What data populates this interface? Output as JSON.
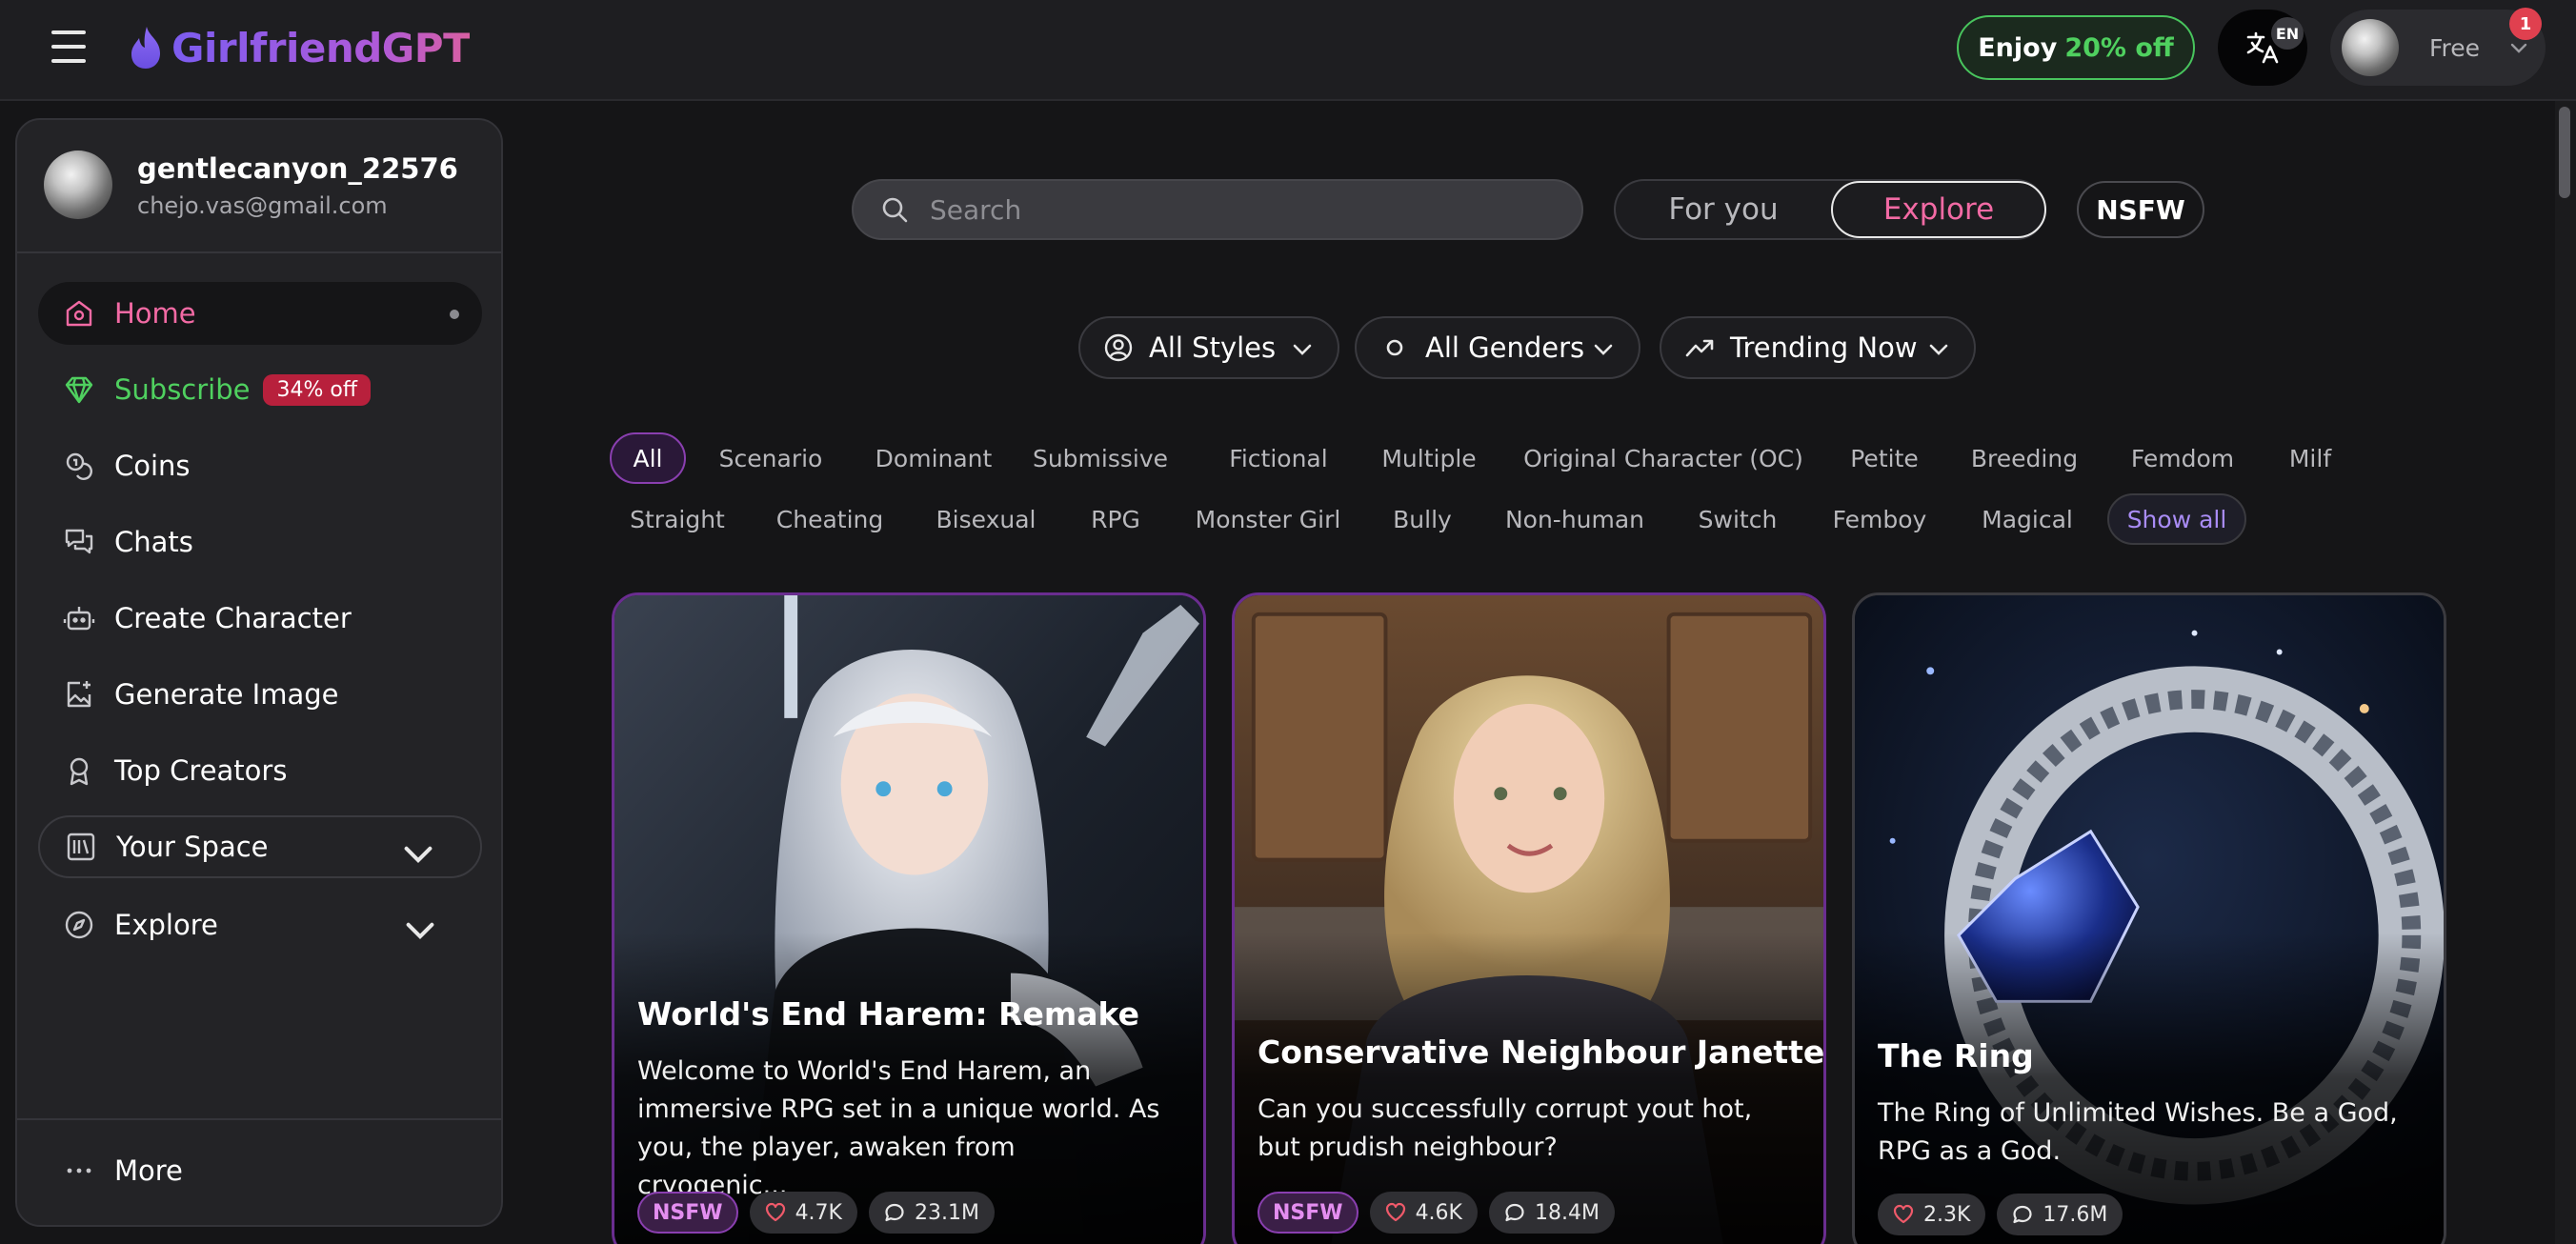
{
  "app": {
    "name": "GirlfriendGPT"
  },
  "header": {
    "promo_prefix": "Enjoy",
    "promo_accent": "20% off",
    "language_badge": "EN",
    "plan_label": "Free",
    "notification_count": "1"
  },
  "user": {
    "name": "gentlecanyon_22576",
    "email": "chejo.vas@gmail.com"
  },
  "sidebar": {
    "items": [
      {
        "label": "Home",
        "icon": "home-icon"
      },
      {
        "label": "Subscribe",
        "badge": "34% off",
        "icon": "gem-icon"
      },
      {
        "label": "Coins",
        "icon": "coins-icon"
      },
      {
        "label": "Chats",
        "icon": "chats-icon"
      },
      {
        "label": "Create Character",
        "icon": "robot-icon"
      },
      {
        "label": "Generate Image",
        "icon": "image-plus-icon"
      },
      {
        "label": "Top Creators",
        "icon": "award-icon"
      },
      {
        "label": "Your Space",
        "icon": "library-icon"
      },
      {
        "label": "Explore",
        "icon": "compass-icon"
      }
    ],
    "more_label": "More"
  },
  "search": {
    "placeholder": "Search"
  },
  "feed_toggle": {
    "options": [
      "For you",
      "Explore"
    ],
    "selected": "Explore"
  },
  "nsfw_toggle": {
    "label": "NSFW"
  },
  "filters": [
    {
      "label": "All Styles",
      "icon": "user-circle-icon"
    },
    {
      "label": "All Genders",
      "icon": "circle-icon"
    },
    {
      "label": "Trending Now",
      "icon": "trending-up-icon"
    }
  ],
  "tags": {
    "row1": [
      "All",
      "Scenario",
      "Dominant",
      "Submissive",
      "Fictional",
      "Multiple",
      "Original Character (OC)",
      "Petite",
      "Breeding",
      "Femdom",
      "Milf"
    ],
    "row2": [
      "Straight",
      "Cheating",
      "Bisexual",
      "RPG",
      "Monster Girl",
      "Bully",
      "Non-human",
      "Switch",
      "Femboy",
      "Magical",
      "Show all"
    ],
    "selected": "All"
  },
  "cards": [
    {
      "title": "World's End Harem: Remake",
      "description": "Welcome to World's End Harem, an immersive RPG set in a unique world. As you, the player, awaken from cryogenic...",
      "nsfw": "NSFW",
      "likes": "4.7K",
      "chats": "23.1M"
    },
    {
      "title": "Conservative Neighbour Janette",
      "description": "Can you successfully corrupt yout hot, but prudish neighbour?",
      "nsfw": "NSFW",
      "likes": "4.6K",
      "chats": "18.4M"
    },
    {
      "title": "The Ring",
      "description": "The Ring of Unlimited Wishes. Be a God, RPG as a God.",
      "likes": "2.3K",
      "chats": "17.6M"
    }
  ],
  "colors": {
    "accent_pink": "#f26aa4",
    "accent_green": "#4fd05f",
    "accent_purple": "#8a3fb0",
    "background": "#151517"
  }
}
